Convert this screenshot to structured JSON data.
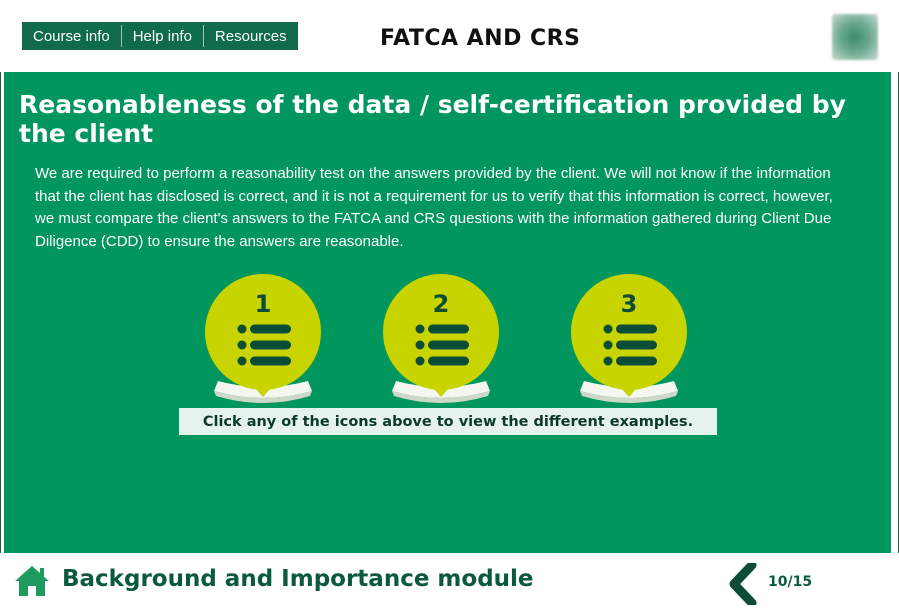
{
  "header": {
    "nav": [
      {
        "label": "Course info"
      },
      {
        "label": "Help info"
      },
      {
        "label": "Resources"
      }
    ],
    "course_title": "FATCA AND CRS",
    "logo_icon": "blurred-logo"
  },
  "main": {
    "heading": "Reasonableness of the data / self-certification provided by the client",
    "intro": "We are required to perform a reasonability test on the answers provided by the client. We will not know if the information that the client has disclosed is correct, and it is not a requirement for us to verify that this information is correct, however, we must compare the client's answers to the FATCA and CRS questions with the information gathered during Client Due Diligence (CDD) to ensure the answers are reasonable.",
    "examples": [
      {
        "number": "1",
        "icon": "list-icon"
      },
      {
        "number": "2",
        "icon": "list-icon"
      },
      {
        "number": "3",
        "icon": "list-icon"
      }
    ],
    "instruction": "Click any of the icons above to view the different examples."
  },
  "footer": {
    "home_icon": "home-icon",
    "module_title": "Background and Importance module",
    "back_icon": "chevron-left-icon",
    "page_count": "10/15"
  },
  "colors": {
    "primary_green": "#00965e",
    "nav_green": "#0f6b4b",
    "dark_green": "#0b5a3e",
    "lime": "#c8d400",
    "instruction_bg": "#e6f2ec"
  }
}
